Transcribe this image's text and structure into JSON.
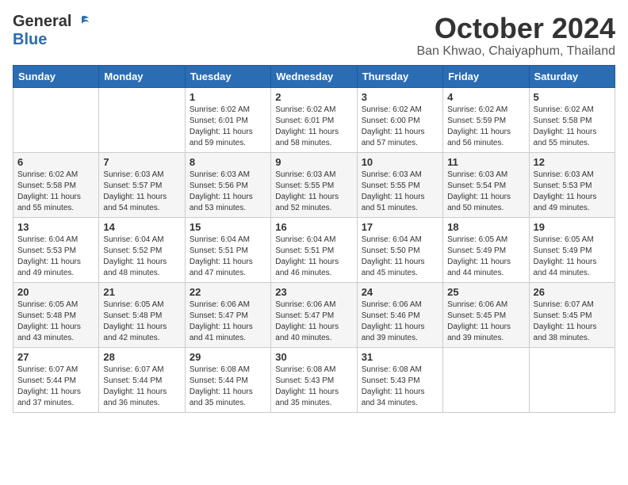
{
  "header": {
    "logo_general": "General",
    "logo_blue": "Blue",
    "month_title": "October 2024",
    "location": "Ban Khwao, Chaiyaphum, Thailand"
  },
  "weekdays": [
    "Sunday",
    "Monday",
    "Tuesday",
    "Wednesday",
    "Thursday",
    "Friday",
    "Saturday"
  ],
  "weeks": [
    [
      {
        "day": "",
        "info": ""
      },
      {
        "day": "",
        "info": ""
      },
      {
        "day": "1",
        "info": "Sunrise: 6:02 AM\nSunset: 6:01 PM\nDaylight: 11 hours and 59 minutes."
      },
      {
        "day": "2",
        "info": "Sunrise: 6:02 AM\nSunset: 6:01 PM\nDaylight: 11 hours and 58 minutes."
      },
      {
        "day": "3",
        "info": "Sunrise: 6:02 AM\nSunset: 6:00 PM\nDaylight: 11 hours and 57 minutes."
      },
      {
        "day": "4",
        "info": "Sunrise: 6:02 AM\nSunset: 5:59 PM\nDaylight: 11 hours and 56 minutes."
      },
      {
        "day": "5",
        "info": "Sunrise: 6:02 AM\nSunset: 5:58 PM\nDaylight: 11 hours and 55 minutes."
      }
    ],
    [
      {
        "day": "6",
        "info": "Sunrise: 6:02 AM\nSunset: 5:58 PM\nDaylight: 11 hours and 55 minutes."
      },
      {
        "day": "7",
        "info": "Sunrise: 6:03 AM\nSunset: 5:57 PM\nDaylight: 11 hours and 54 minutes."
      },
      {
        "day": "8",
        "info": "Sunrise: 6:03 AM\nSunset: 5:56 PM\nDaylight: 11 hours and 53 minutes."
      },
      {
        "day": "9",
        "info": "Sunrise: 6:03 AM\nSunset: 5:55 PM\nDaylight: 11 hours and 52 minutes."
      },
      {
        "day": "10",
        "info": "Sunrise: 6:03 AM\nSunset: 5:55 PM\nDaylight: 11 hours and 51 minutes."
      },
      {
        "day": "11",
        "info": "Sunrise: 6:03 AM\nSunset: 5:54 PM\nDaylight: 11 hours and 50 minutes."
      },
      {
        "day": "12",
        "info": "Sunrise: 6:03 AM\nSunset: 5:53 PM\nDaylight: 11 hours and 49 minutes."
      }
    ],
    [
      {
        "day": "13",
        "info": "Sunrise: 6:04 AM\nSunset: 5:53 PM\nDaylight: 11 hours and 49 minutes."
      },
      {
        "day": "14",
        "info": "Sunrise: 6:04 AM\nSunset: 5:52 PM\nDaylight: 11 hours and 48 minutes."
      },
      {
        "day": "15",
        "info": "Sunrise: 6:04 AM\nSunset: 5:51 PM\nDaylight: 11 hours and 47 minutes."
      },
      {
        "day": "16",
        "info": "Sunrise: 6:04 AM\nSunset: 5:51 PM\nDaylight: 11 hours and 46 minutes."
      },
      {
        "day": "17",
        "info": "Sunrise: 6:04 AM\nSunset: 5:50 PM\nDaylight: 11 hours and 45 minutes."
      },
      {
        "day": "18",
        "info": "Sunrise: 6:05 AM\nSunset: 5:49 PM\nDaylight: 11 hours and 44 minutes."
      },
      {
        "day": "19",
        "info": "Sunrise: 6:05 AM\nSunset: 5:49 PM\nDaylight: 11 hours and 44 minutes."
      }
    ],
    [
      {
        "day": "20",
        "info": "Sunrise: 6:05 AM\nSunset: 5:48 PM\nDaylight: 11 hours and 43 minutes."
      },
      {
        "day": "21",
        "info": "Sunrise: 6:05 AM\nSunset: 5:48 PM\nDaylight: 11 hours and 42 minutes."
      },
      {
        "day": "22",
        "info": "Sunrise: 6:06 AM\nSunset: 5:47 PM\nDaylight: 11 hours and 41 minutes."
      },
      {
        "day": "23",
        "info": "Sunrise: 6:06 AM\nSunset: 5:47 PM\nDaylight: 11 hours and 40 minutes."
      },
      {
        "day": "24",
        "info": "Sunrise: 6:06 AM\nSunset: 5:46 PM\nDaylight: 11 hours and 39 minutes."
      },
      {
        "day": "25",
        "info": "Sunrise: 6:06 AM\nSunset: 5:45 PM\nDaylight: 11 hours and 39 minutes."
      },
      {
        "day": "26",
        "info": "Sunrise: 6:07 AM\nSunset: 5:45 PM\nDaylight: 11 hours and 38 minutes."
      }
    ],
    [
      {
        "day": "27",
        "info": "Sunrise: 6:07 AM\nSunset: 5:44 PM\nDaylight: 11 hours and 37 minutes."
      },
      {
        "day": "28",
        "info": "Sunrise: 6:07 AM\nSunset: 5:44 PM\nDaylight: 11 hours and 36 minutes."
      },
      {
        "day": "29",
        "info": "Sunrise: 6:08 AM\nSunset: 5:44 PM\nDaylight: 11 hours and 35 minutes."
      },
      {
        "day": "30",
        "info": "Sunrise: 6:08 AM\nSunset: 5:43 PM\nDaylight: 11 hours and 35 minutes."
      },
      {
        "day": "31",
        "info": "Sunrise: 6:08 AM\nSunset: 5:43 PM\nDaylight: 11 hours and 34 minutes."
      },
      {
        "day": "",
        "info": ""
      },
      {
        "day": "",
        "info": ""
      }
    ]
  ]
}
